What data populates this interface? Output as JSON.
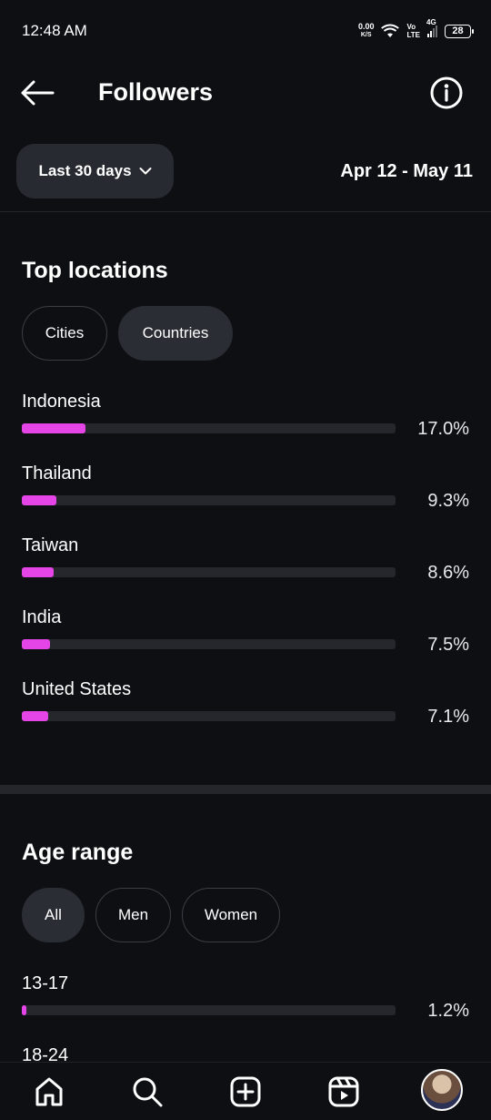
{
  "status_bar": {
    "time": "12:48 AM",
    "net_speed": "0.00",
    "net_unit": "K/S",
    "volte_top": "Vo",
    "volte_bottom": "LTE",
    "network": "4G",
    "battery": "28"
  },
  "header": {
    "title": "Followers"
  },
  "filter": {
    "range_label": "Last 30 days",
    "date_range": "Apr 12 - May 11"
  },
  "top_locations": {
    "title": "Top locations",
    "tabs": [
      {
        "label": "Cities",
        "active": false
      },
      {
        "label": "Countries",
        "active": true
      }
    ],
    "items": [
      {
        "name": "Indonesia",
        "percent_label": "17.0%",
        "value": 17.0
      },
      {
        "name": "Thailand",
        "percent_label": "9.3%",
        "value": 9.3
      },
      {
        "name": "Taiwan",
        "percent_label": "8.6%",
        "value": 8.6
      },
      {
        "name": "India",
        "percent_label": "7.5%",
        "value": 7.5
      },
      {
        "name": "United States",
        "percent_label": "7.1%",
        "value": 7.1
      }
    ]
  },
  "age_range": {
    "title": "Age range",
    "tabs": [
      {
        "label": "All",
        "active": true
      },
      {
        "label": "Men",
        "active": false
      },
      {
        "label": "Women",
        "active": false
      }
    ],
    "items": [
      {
        "name": "13-17",
        "percent_label": "1.2%",
        "value": 1.2
      },
      {
        "name": "18-24"
      }
    ]
  },
  "bottom_nav": {
    "icons": [
      "home-icon",
      "search-icon",
      "create-icon",
      "reels-icon",
      "profile-avatar"
    ]
  },
  "colors": {
    "accent": "#e545e6",
    "background": "#0e0f13",
    "track": "#25272d"
  }
}
